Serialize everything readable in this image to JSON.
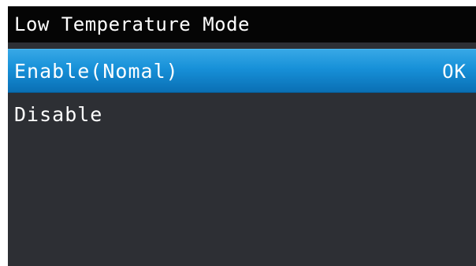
{
  "header": {
    "title": "Low Temperature Mode"
  },
  "menu": {
    "items": [
      {
        "label": "Enable(Nomal)",
        "badge": "OK",
        "selected": true
      },
      {
        "label": "Disable",
        "badge": "",
        "selected": false
      }
    ]
  },
  "colors": {
    "title_bg": "#050505",
    "screen_bg": "#2d2f34",
    "selected_bg": "#1790d8",
    "text": "#ffffff"
  }
}
